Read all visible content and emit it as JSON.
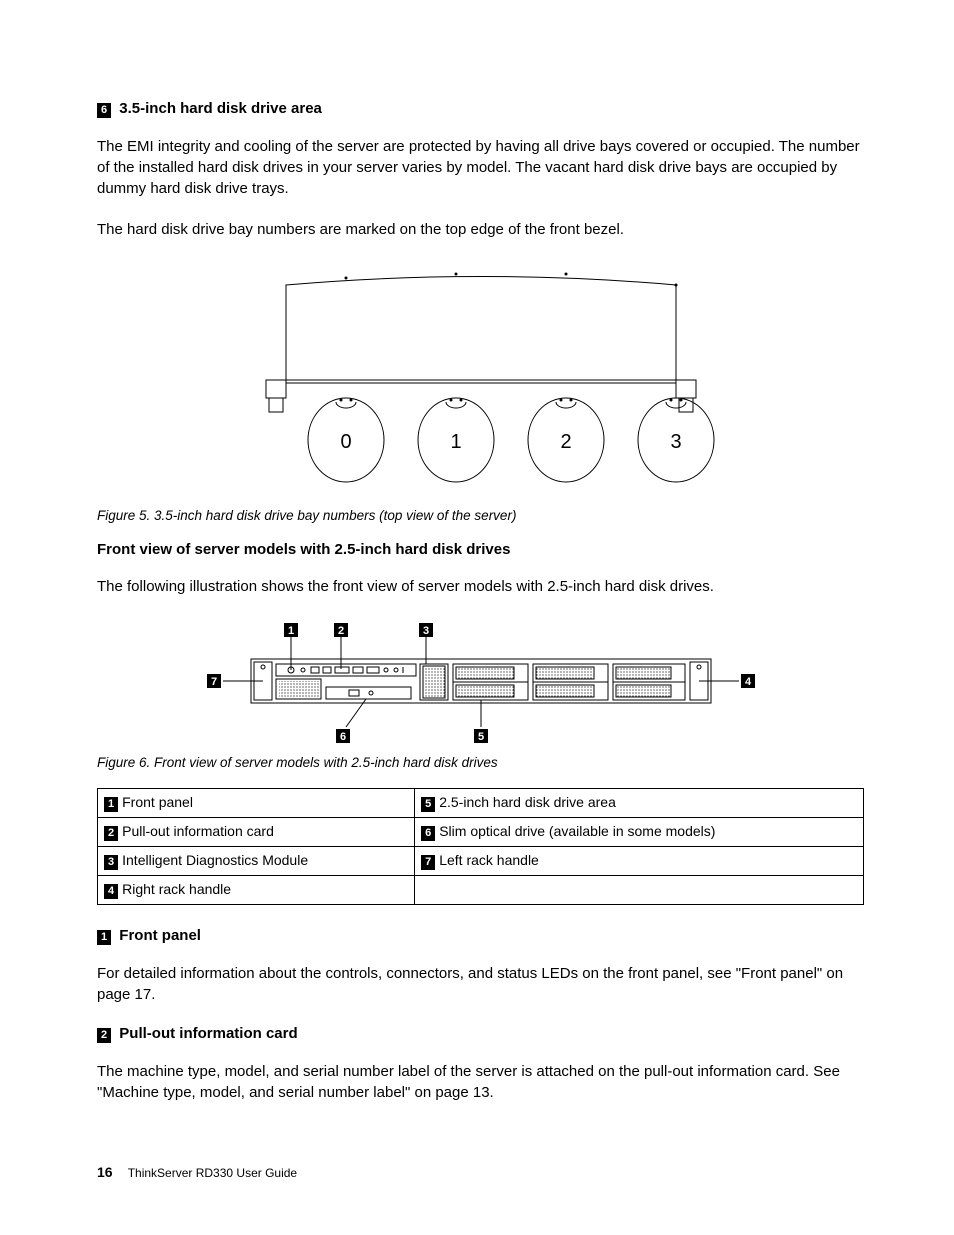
{
  "sec35": {
    "callout": "6",
    "title": "3.5-inch hard disk drive area",
    "p1": "The EMI integrity and cooling of the server are protected by having all drive bays covered or occupied. The number of the installed hard disk drives in your server varies by model. The vacant hard disk drive bays are occupied by dummy hard disk drive trays.",
    "p2": "The hard disk drive bay numbers are marked on the top edge of the front bezel."
  },
  "fig5": {
    "bays": [
      "0",
      "1",
      "2",
      "3"
    ],
    "caption": "Figure 5.  3.5-inch hard disk drive bay numbers (top view of the server)"
  },
  "sec25head": "Front view of server models with 2.5-inch hard disk drives",
  "sec25p": "The following illustration shows the front view of server models with 2.5-inch hard disk drives.",
  "fig6": {
    "topLabels": [
      "1",
      "2",
      "3"
    ],
    "rightLabel": "4",
    "bottomLabels": [
      "6",
      "5"
    ],
    "leftLabel": "7",
    "caption": "Figure 6.  Front view of server models with 2.5-inch hard disk drives"
  },
  "table": {
    "rows": [
      {
        "l_num": "1",
        "l_text": "Front panel",
        "r_num": "5",
        "r_text": "2.5-inch hard disk drive area"
      },
      {
        "l_num": "2",
        "l_text": "Pull-out information card",
        "r_num": "6",
        "r_text": "Slim optical drive (available in some models)"
      },
      {
        "l_num": "3",
        "l_text": "Intelligent Diagnostics Module",
        "r_num": "7",
        "r_text": "Left rack handle"
      },
      {
        "l_num": "4",
        "l_text": "Right rack handle",
        "r_num": "",
        "r_text": ""
      }
    ]
  },
  "detail1": {
    "callout": "1",
    "title": "Front panel",
    "p": "For detailed information about the controls, connectors, and status LEDs on the front panel, see \"Front panel\" on page 17."
  },
  "detail2": {
    "callout": "2",
    "title": "Pull-out information card",
    "p": "The machine type, model, and serial number label of the server is attached on the pull-out information card. See \"Machine type, model, and serial number label\" on page 13."
  },
  "footer": {
    "pagenum": "16",
    "doctitle": "ThinkServer RD330 User Guide"
  }
}
